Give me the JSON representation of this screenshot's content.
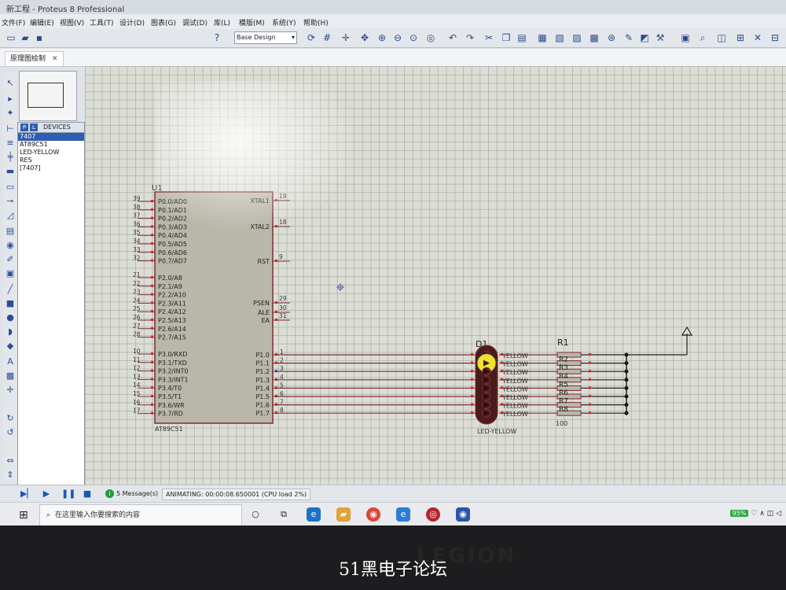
{
  "app": {
    "title": "新工程 - Proteus 8 Professional"
  },
  "menu": [
    "文件(F)",
    "编辑(E)",
    "视图(V)",
    "工具(T)",
    "设计(D)",
    "图表(G)",
    "调试(D)",
    "库(L)",
    "模版(M)",
    "系统(Y)",
    "帮助(H)"
  ],
  "toolbar": {
    "design_combo": "Base Design"
  },
  "tab": {
    "label": "原理图绘制",
    "close": "✕"
  },
  "devices": {
    "header": "DEVICES",
    "p_label": "P",
    "l_label": "L",
    "items": [
      "7407",
      "AT89C51",
      "LED-YELLOW",
      "RES",
      "[7407]"
    ],
    "selected_index": 0
  },
  "schematic": {
    "mcu": {
      "ref": "U1",
      "part": "AT89C51",
      "left_pins": [
        {
          "num": "39",
          "name": "P0.0/AD0"
        },
        {
          "num": "38",
          "name": "P0.1/AD1"
        },
        {
          "num": "37",
          "name": "P0.2/AD2"
        },
        {
          "num": "36",
          "name": "P0.3/AD3"
        },
        {
          "num": "35",
          "name": "P0.4/AD4"
        },
        {
          "num": "34",
          "name": "P0.5/AD5"
        },
        {
          "num": "33",
          "name": "P0.6/AD6"
        },
        {
          "num": "32",
          "name": "P0.7/AD7"
        },
        {
          "num": "21",
          "name": "P2.0/A8"
        },
        {
          "num": "22",
          "name": "P2.1/A9"
        },
        {
          "num": "23",
          "name": "P2.2/A10"
        },
        {
          "num": "24",
          "name": "P2.3/A11"
        },
        {
          "num": "25",
          "name": "P2.4/A12"
        },
        {
          "num": "26",
          "name": "P2.5/A13"
        },
        {
          "num": "27",
          "name": "P2.6/A14"
        },
        {
          "num": "28",
          "name": "P2.7/A15"
        },
        {
          "num": "10",
          "name": "P3.0/RXD"
        },
        {
          "num": "11",
          "name": "P3.1/TXD"
        },
        {
          "num": "12",
          "name": "P3.2/INT0"
        },
        {
          "num": "13",
          "name": "P3.3/INT1"
        },
        {
          "num": "14",
          "name": "P3.4/T0"
        },
        {
          "num": "15",
          "name": "P3.5/T1"
        },
        {
          "num": "16",
          "name": "P3.6/WR"
        },
        {
          "num": "17",
          "name": "P3.7/RD"
        }
      ],
      "right_top": [
        {
          "num": "19",
          "name": "XTAL1"
        },
        {
          "num": "18",
          "name": "XTAL2"
        },
        {
          "num": "9",
          "name": "RST"
        },
        {
          "num": "29",
          "name": "PSEN"
        },
        {
          "num": "30",
          "name": "ALE"
        },
        {
          "num": "31",
          "name": "EA"
        }
      ],
      "right_p1": [
        {
          "num": "1",
          "name": "P1.0"
        },
        {
          "num": "2",
          "name": "P1.1"
        },
        {
          "num": "3",
          "name": "P1.2"
        },
        {
          "num": "4",
          "name": "P1.3"
        },
        {
          "num": "5",
          "name": "P1.4"
        },
        {
          "num": "6",
          "name": "P1.5"
        },
        {
          "num": "7",
          "name": "P1.6"
        },
        {
          "num": "8",
          "name": "P1.7"
        }
      ]
    },
    "led_array": {
      "ref": "D1",
      "part_label": "LED-YELLOW",
      "row_label": "YELLOW",
      "lit_index": 1
    },
    "resistors": {
      "ref": "R1",
      "labels": [
        "R2",
        "R3",
        "R4",
        "R5",
        "R6",
        "R7",
        "R8"
      ],
      "value": "100"
    }
  },
  "status": {
    "messages": "5 Message(s)",
    "animating": "ANIMATING: 00:00:08.650001 (CPU load 2%)"
  },
  "taskbar": {
    "search_placeholder": "在这里输入你要搜索的内容",
    "battery": "95%"
  },
  "bezel": {
    "brand": "LEGION"
  },
  "watermark": "51黑电子论坛"
}
